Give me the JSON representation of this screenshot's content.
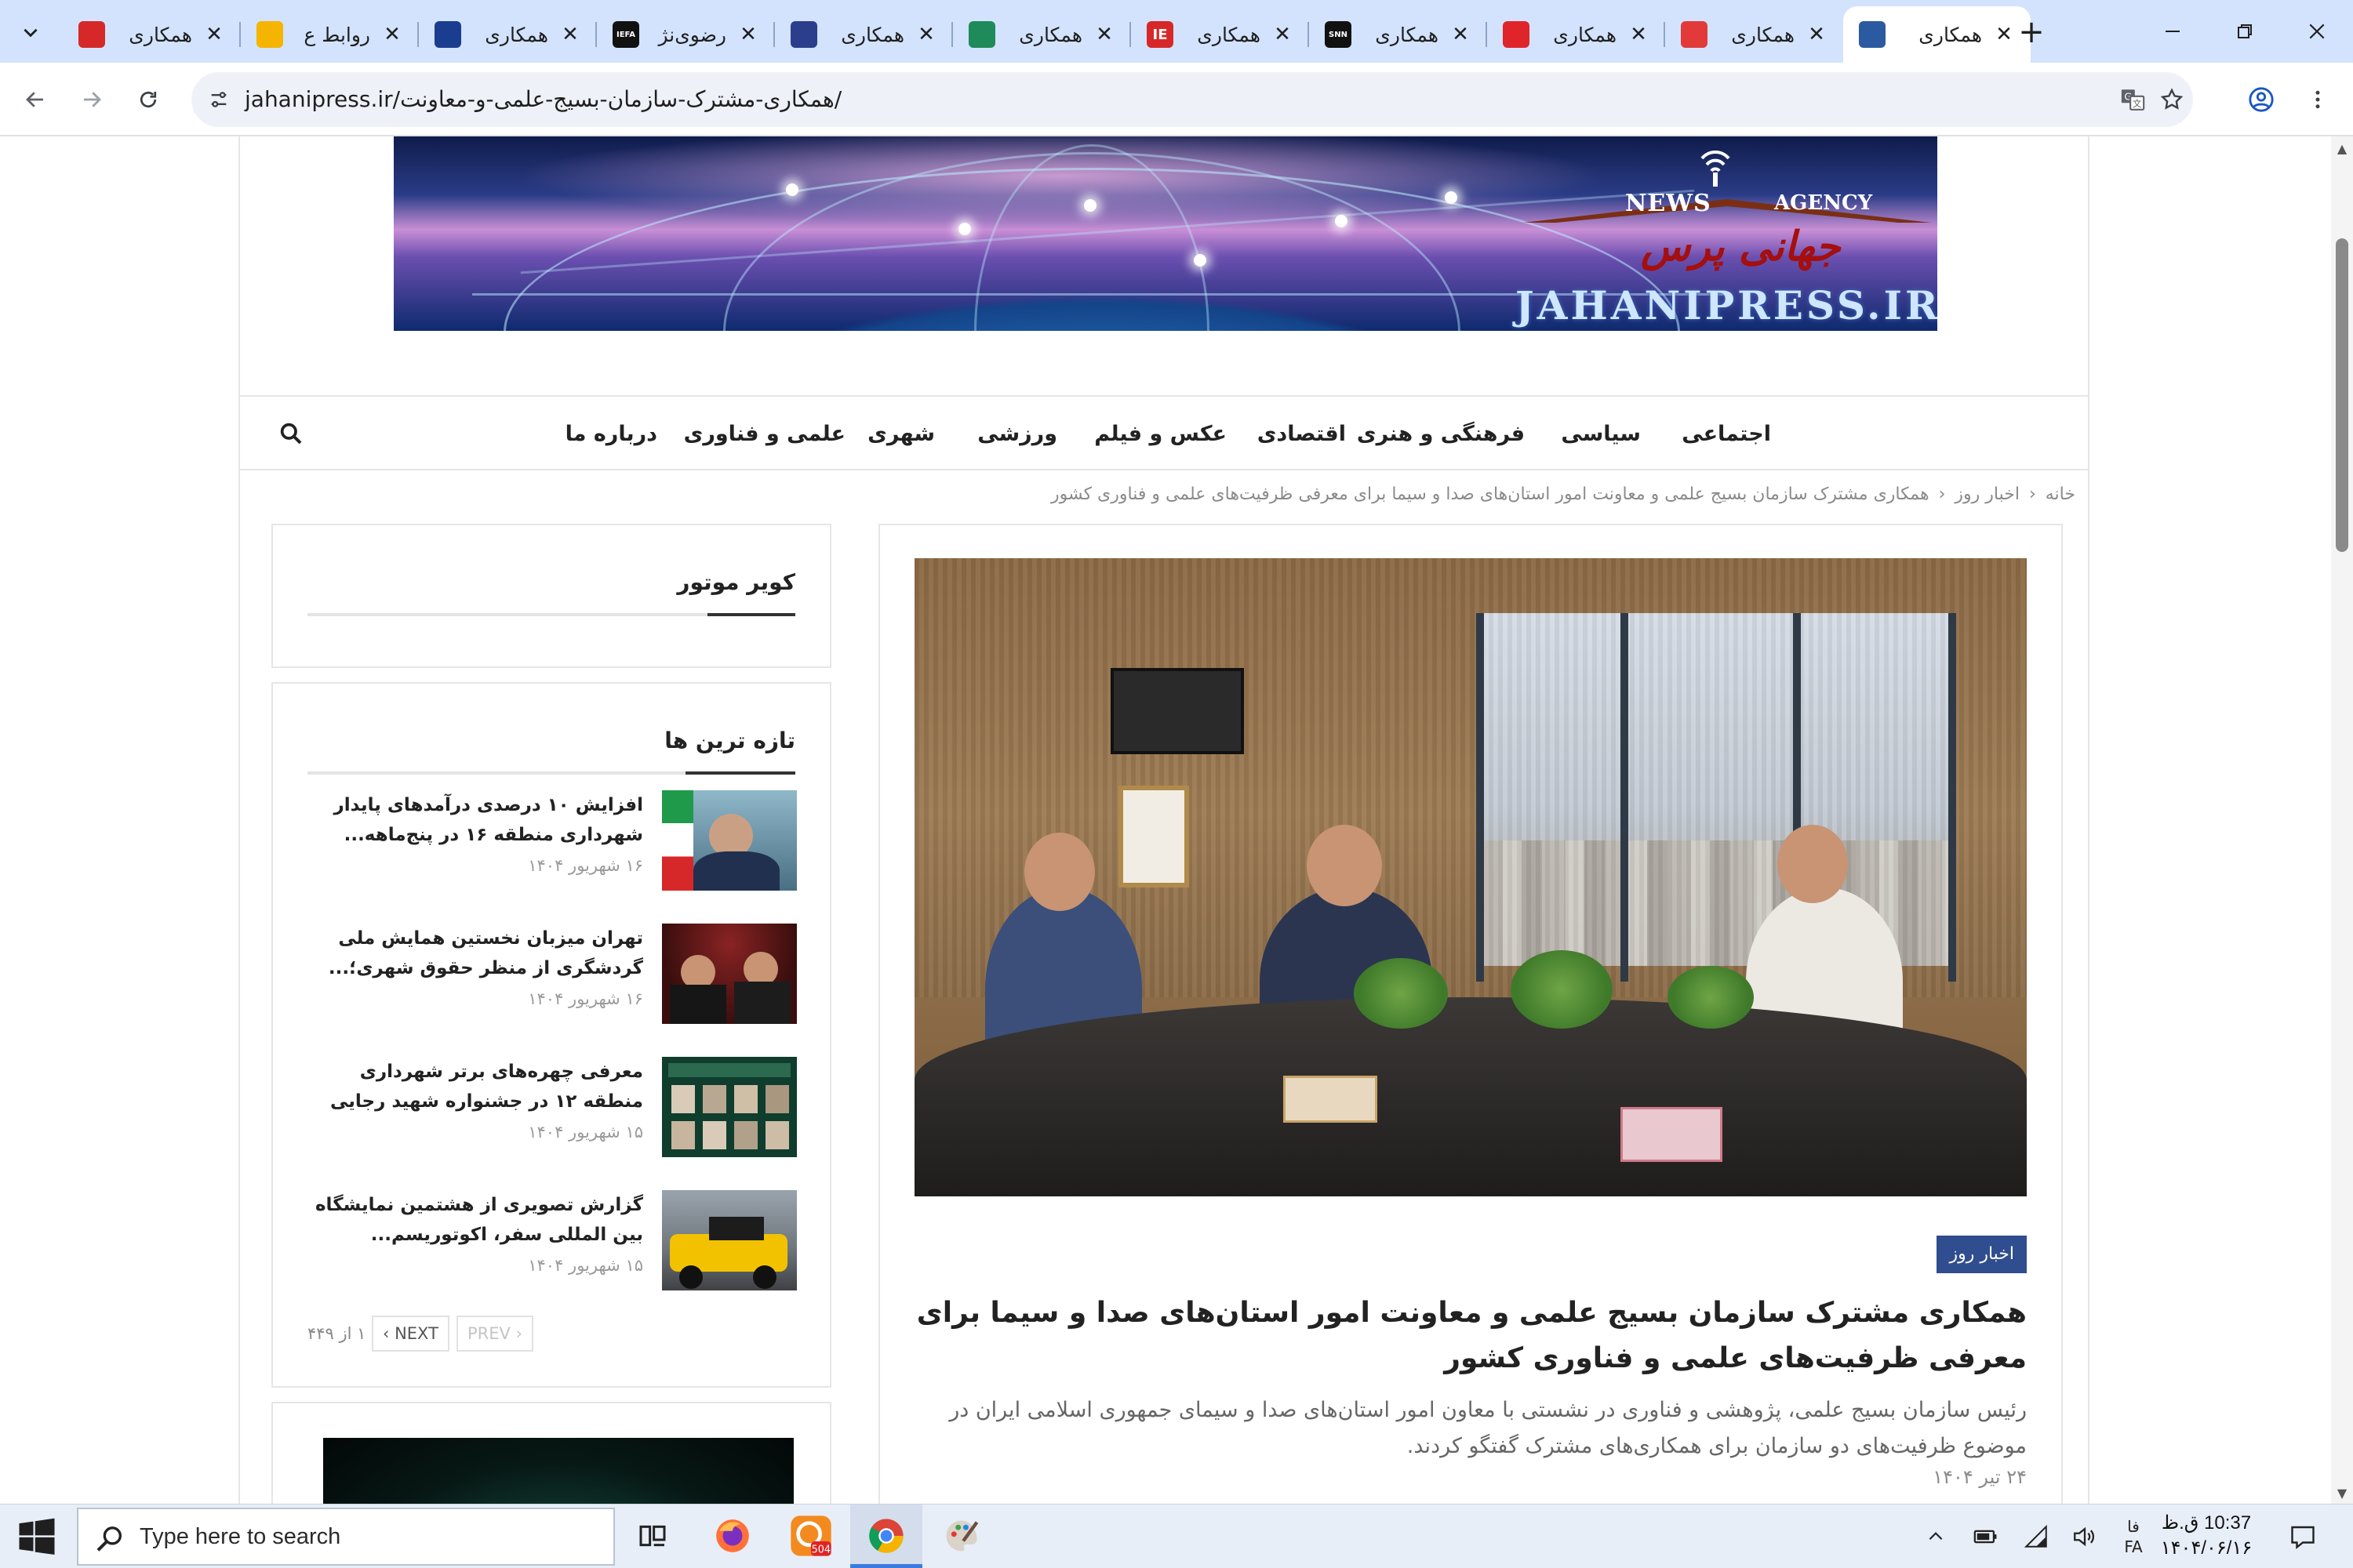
{
  "browser": {
    "tabs": [
      {
        "title": "همکاری",
        "favicon": "red-logo",
        "color": "#d62828",
        "active": false
      },
      {
        "title": "روابط ع",
        "favicon": "diamond-logo",
        "color": "#f5b400",
        "active": false
      },
      {
        "title": "همکاری",
        "favicon": "cog-logo",
        "color": "#1a3d8f",
        "active": false
      },
      {
        "title": "رضوی‌نژ",
        "favicon": "iefa-logo",
        "label": "IEFA",
        "color": "#111111",
        "active": false
      },
      {
        "title": "همکاری",
        "favicon": "blue-square-logo",
        "color": "#2b3e8c",
        "active": false
      },
      {
        "title": "همکاری",
        "favicon": "arch-logo",
        "color": "#1f8a5a",
        "active": false
      },
      {
        "title": "همکاری",
        "favicon": "ie-logo",
        "label": "IE",
        "color": "#d62828",
        "active": false
      },
      {
        "title": "همکاری",
        "favicon": "snn-logo",
        "label": "SNN",
        "color": "#111111",
        "active": false
      },
      {
        "title": "همکاری",
        "favicon": "red-wave-logo",
        "color": "#e0252a",
        "active": false
      },
      {
        "title": "همکاری",
        "favicon": "red-circle-logo",
        "color": "#e23a3a",
        "active": false
      },
      {
        "title": "همکاری",
        "favicon": "jahanipress-logo",
        "color": "#2c5aa0",
        "active": true
      }
    ],
    "url": "jahanipress.ir/همکاری-مشترک-سازمان-بسیج-علمی-و-معاونت/"
  },
  "site": {
    "banner": {
      "news": "NEWS",
      "agency": "AGENCY",
      "persian_name": "جهانی پرس",
      "domain": "JAHANIPRESS.IR"
    },
    "menu": [
      "اجتماعی",
      "سیاسی",
      "فرهنگی و هنری",
      "اقتصادی",
      "عکس و فیلم",
      "ورزشی",
      "شهری",
      "علمی و فناوری",
      "درباره ما"
    ],
    "breadcrumb": {
      "home": "خانه",
      "section": "اخبار روز",
      "current": "همکاری مشترک سازمان بسیج علمی و معاونت امور استان‌های صدا و سیما برای معرفی ظرفیت‌های علمی و فناوری کشور"
    }
  },
  "article": {
    "category": "اخبار روز",
    "title": "همکاری مشترک سازمان بسیج علمی و معاونت امور استان‌های صدا و سیما برای معرفی ظرفیت‌های علمی و فناوری کشور",
    "lead": "رئیس سازمان بسیج علمی، پژوهشی و فناوری در نشستی با معاون امور استان‌های صدا و سیمای جمهوری اسلامی ایران در موضوع ظرفیت‌های دو سازمان برای همکاری‌های مشترک گفتگو کردند.",
    "date": "۲۴ تیر ۱۴۰۴"
  },
  "sidebar": {
    "widget1_title": "کویر موتور",
    "latest_title": "تازه ترین ها",
    "posts": [
      {
        "title": "افزایش ۱۰ درصدی درآمدهای پایدار شهرداری منطقه ۱۶ در پنج‌ماهه...",
        "date": "۱۶ شهریور ۱۴۰۴"
      },
      {
        "title": "تهران میزبان نخستین همایش ملی گردشگری از منظر حقوق شهری؛...",
        "date": "۱۶ شهریور ۱۴۰۴"
      },
      {
        "title": "معرفی چهره‌های برتر شهرداری منطقه ۱۲ در جشنواره شهید رجایی",
        "date": "۱۵ شهریور ۱۴۰۴"
      },
      {
        "title": "گزارش تصویری از هشتمین نمایشگاه بین المللی سفر، اکوتوریسم...",
        "date": "۱۵ شهریور ۱۴۰۴"
      }
    ],
    "pager": {
      "prev": "PREV",
      "next": "NEXT",
      "info": "۱ از ۴۴۹"
    }
  },
  "taskbar": {
    "search_placeholder": "Type here to search",
    "badge": "504",
    "lang_top": "فا",
    "lang_bottom": "FA",
    "time": "10:37 ق.ظ",
    "date": "۱۴۰۴/۰۶/۱۶"
  }
}
